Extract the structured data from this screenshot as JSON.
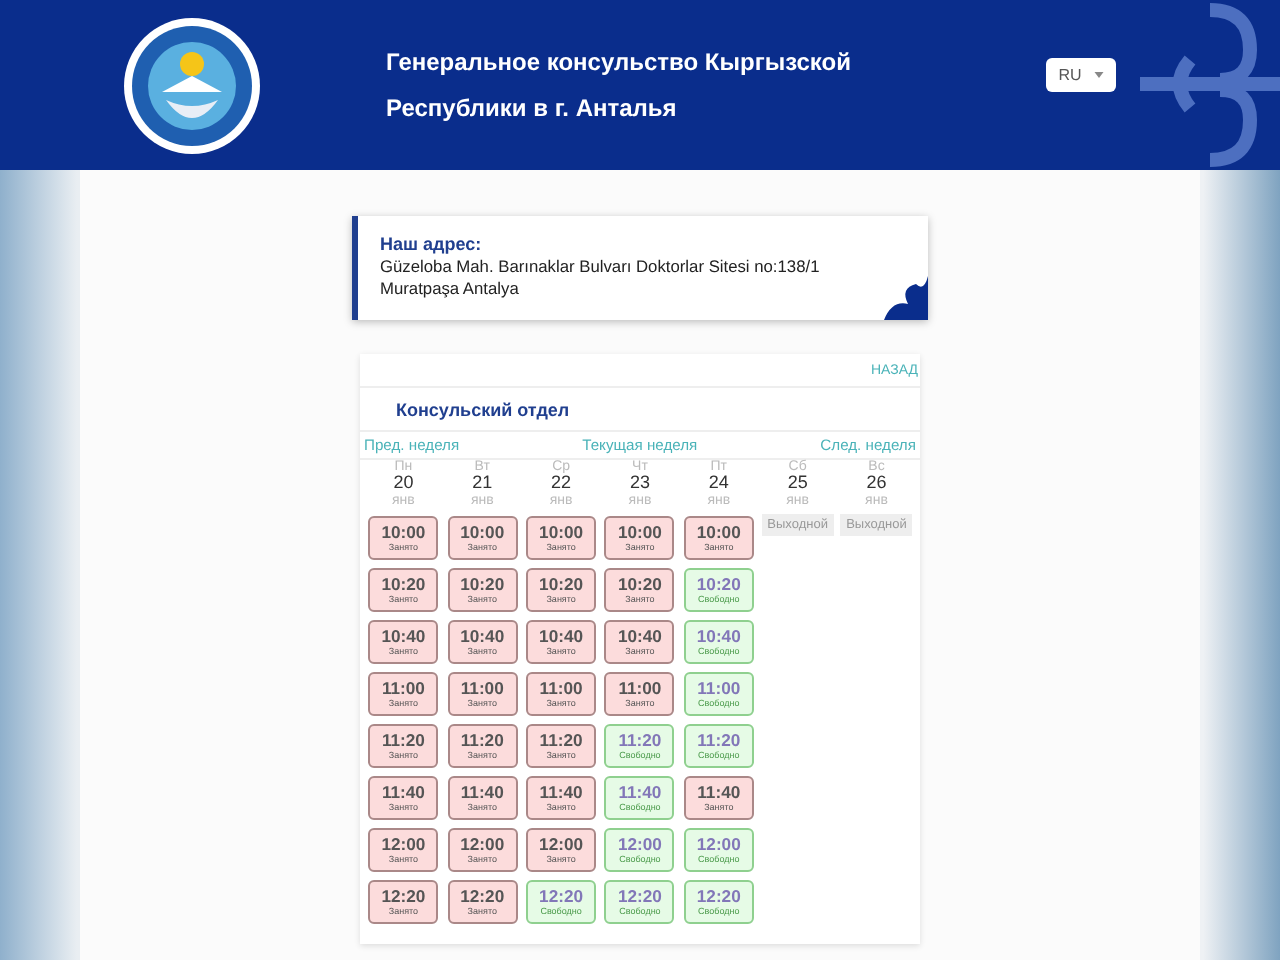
{
  "header": {
    "title_line_1": "Генеральное консульство Кыргызской",
    "title_line_2": "Республики в г. Анталья",
    "language": "RU"
  },
  "address": {
    "label": "Наш адрес:",
    "line_1": "Güzeloba Mah. Barınaklar Bulvarı Doktorlar Sitesi no:138/1",
    "line_2": "Muratpaşa Antalya"
  },
  "schedule": {
    "back_link": "НАЗАД",
    "title": "Консульский отдел",
    "prev_week": "Пред. неделя",
    "current_week": "Текущая неделя",
    "next_week": "След. неделя",
    "days": [
      {
        "weekday": "Пн",
        "date": "20",
        "month": "янв",
        "kind": "work",
        "slots": [
          {
            "time": "10:00",
            "status": "Занято",
            "free": false
          },
          {
            "time": "10:20",
            "status": "Занято",
            "free": false
          },
          {
            "time": "10:40",
            "status": "Занято",
            "free": false
          },
          {
            "time": "11:00",
            "status": "Занято",
            "free": false
          },
          {
            "time": "11:20",
            "status": "Занято",
            "free": false
          },
          {
            "time": "11:40",
            "status": "Занято",
            "free": false
          },
          {
            "time": "12:00",
            "status": "Занято",
            "free": false
          },
          {
            "time": "12:20",
            "status": "Занято",
            "free": false
          }
        ]
      },
      {
        "weekday": "Вт",
        "date": "21",
        "month": "янв",
        "kind": "work",
        "slots": [
          {
            "time": "10:00",
            "status": "Занято",
            "free": false
          },
          {
            "time": "10:20",
            "status": "Занято",
            "free": false
          },
          {
            "time": "10:40",
            "status": "Занято",
            "free": false
          },
          {
            "time": "11:00",
            "status": "Занято",
            "free": false
          },
          {
            "time": "11:20",
            "status": "Занято",
            "free": false
          },
          {
            "time": "11:40",
            "status": "Занято",
            "free": false
          },
          {
            "time": "12:00",
            "status": "Занято",
            "free": false
          },
          {
            "time": "12:20",
            "status": "Занято",
            "free": false
          }
        ]
      },
      {
        "weekday": "Ср",
        "date": "22",
        "month": "янв",
        "kind": "work",
        "slots": [
          {
            "time": "10:00",
            "status": "Занято",
            "free": false
          },
          {
            "time": "10:20",
            "status": "Занято",
            "free": false
          },
          {
            "time": "10:40",
            "status": "Занято",
            "free": false
          },
          {
            "time": "11:00",
            "status": "Занято",
            "free": false
          },
          {
            "time": "11:20",
            "status": "Занято",
            "free": false
          },
          {
            "time": "11:40",
            "status": "Занято",
            "free": false
          },
          {
            "time": "12:00",
            "status": "Занято",
            "free": false
          },
          {
            "time": "12:20",
            "status": "Свободно",
            "free": true
          }
        ]
      },
      {
        "weekday": "Чт",
        "date": "23",
        "month": "янв",
        "kind": "work",
        "slots": [
          {
            "time": "10:00",
            "status": "Занято",
            "free": false
          },
          {
            "time": "10:20",
            "status": "Занято",
            "free": false
          },
          {
            "time": "10:40",
            "status": "Занято",
            "free": false
          },
          {
            "time": "11:00",
            "status": "Занято",
            "free": false
          },
          {
            "time": "11:20",
            "status": "Свободно",
            "free": true
          },
          {
            "time": "11:40",
            "status": "Свободно",
            "free": true
          },
          {
            "time": "12:00",
            "status": "Свободно",
            "free": true
          },
          {
            "time": "12:20",
            "status": "Свободно",
            "free": true
          }
        ]
      },
      {
        "weekday": "Пт",
        "date": "24",
        "month": "янв",
        "kind": "work",
        "slots": [
          {
            "time": "10:00",
            "status": "Занято",
            "free": false
          },
          {
            "time": "10:20",
            "status": "Свободно",
            "free": true
          },
          {
            "time": "10:40",
            "status": "Свободно",
            "free": true
          },
          {
            "time": "11:00",
            "status": "Свободно",
            "free": true
          },
          {
            "time": "11:20",
            "status": "Свободно",
            "free": true
          },
          {
            "time": "11:40",
            "status": "Занято",
            "free": false
          },
          {
            "time": "12:00",
            "status": "Свободно",
            "free": true
          },
          {
            "time": "12:20",
            "status": "Свободно",
            "free": true
          }
        ]
      },
      {
        "weekday": "Сб",
        "date": "25",
        "month": "янв",
        "kind": "off",
        "off_label": "Выходной"
      },
      {
        "weekday": "Вс",
        "date": "26",
        "month": "янв",
        "kind": "off",
        "off_label": "Выходной"
      }
    ]
  }
}
